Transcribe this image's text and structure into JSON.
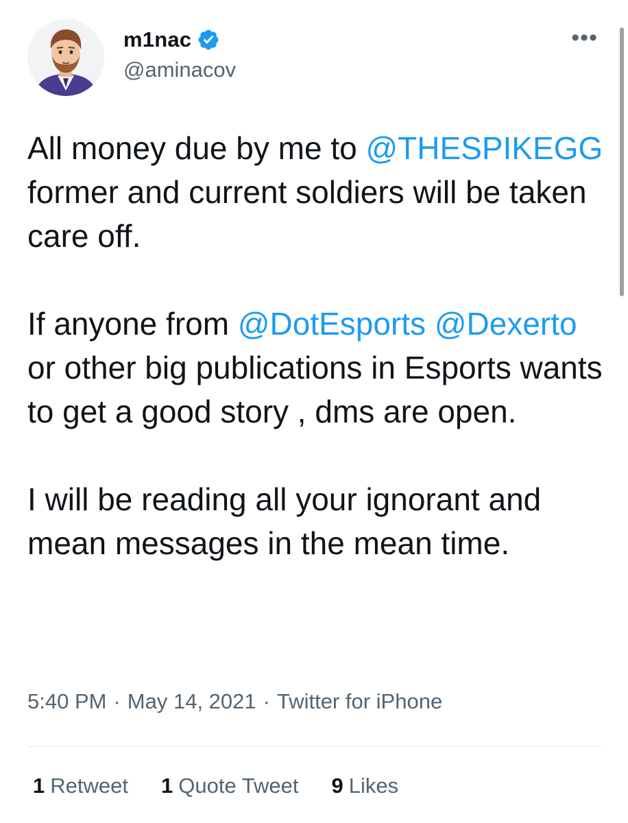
{
  "user": {
    "display_name": "m1nac",
    "handle": "@aminacov",
    "verified": true,
    "avatar_icon": "cartoon-avatar-icon",
    "verified_icon": "verified-badge-icon"
  },
  "more_label": "•••",
  "tweet": {
    "paragraph1": {
      "before": "All money due by me to ",
      "mention": "@THESPIKEGG",
      "after": " former and current soldiers will be taken care off."
    },
    "paragraph2": {
      "before": "If anyone from ",
      "mention1": "@DotEsports",
      "between": " ",
      "mention2": "@Dexerto",
      "after": " or other big publications in Esports wants to get a good story , dms are open."
    },
    "paragraph3": "I will be reading all your ignorant and mean messages in the mean time."
  },
  "meta": {
    "time": "5:40 PM",
    "separator": "·",
    "date": "May 14, 2021",
    "source": "Twitter for iPhone"
  },
  "stats": {
    "retweets": {
      "count": "1",
      "label": "Retweet"
    },
    "quote_tweets": {
      "count": "1",
      "label": "Quote Tweet"
    },
    "likes": {
      "count": "9",
      "label": "Likes"
    }
  },
  "colors": {
    "link": "#1d9bf0",
    "text": "#0f1419",
    "secondary": "#536471"
  }
}
